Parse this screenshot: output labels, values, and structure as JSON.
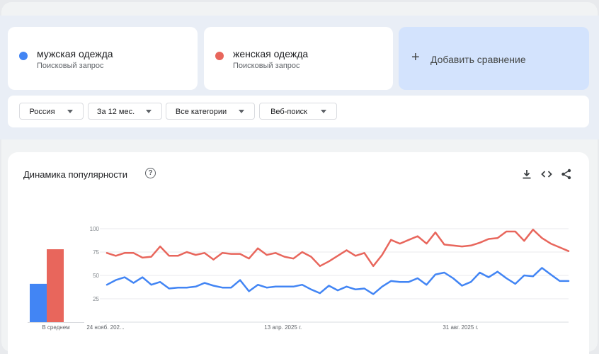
{
  "terms": [
    {
      "name": "мужская одежда",
      "sub": "Поисковый запрос",
      "color": "#4285f4"
    },
    {
      "name": "женская одежда",
      "sub": "Поисковый запрос",
      "color": "#e8665c"
    }
  ],
  "add_compare": {
    "label": "Добавить сравнение",
    "icon": "plus-icon"
  },
  "filters": [
    {
      "label": "Россия"
    },
    {
      "label": "За 12 мес."
    },
    {
      "label": "Все категории"
    },
    {
      "label": "Веб-поиск"
    }
  ],
  "panel": {
    "title": "Динамика популярности",
    "help_icon": "help-icon",
    "actions": [
      "download-icon",
      "embed-code-icon",
      "share-icon"
    ]
  },
  "chart_data": {
    "type": "line",
    "title": "",
    "ylim": [
      0,
      100
    ],
    "yticks": [
      25,
      50,
      75,
      100
    ],
    "x_labels": [
      "24 нояб. 202...",
      "13 апр. 2025 г.",
      "31 авг. 2025 г."
    ],
    "x_label_indices": [
      0,
      20,
      40
    ],
    "grid": true,
    "average": {
      "label": "В среднем",
      "values": [
        41,
        78
      ]
    },
    "series": [
      {
        "name": "мужская одежда",
        "color": "#4285f4",
        "values": [
          40,
          45,
          48,
          42,
          48,
          40,
          43,
          36,
          37,
          37,
          38,
          42,
          39,
          37,
          37,
          45,
          33,
          40,
          37,
          38,
          38,
          38,
          40,
          35,
          31,
          39,
          34,
          38,
          35,
          36,
          30,
          38,
          44,
          43,
          43,
          47,
          40,
          51,
          53,
          47,
          39,
          43,
          53,
          48,
          54,
          47,
          41,
          50,
          49,
          58,
          51,
          44,
          44
        ]
      },
      {
        "name": "женская одежда",
        "color": "#e8665c",
        "values": [
          74,
          71,
          74,
          74,
          69,
          70,
          81,
          71,
          71,
          75,
          72,
          74,
          67,
          74,
          73,
          73,
          68,
          79,
          72,
          74,
          70,
          68,
          75,
          70,
          60,
          65,
          71,
          77,
          71,
          74,
          60,
          72,
          88,
          84,
          88,
          92,
          84,
          96,
          83,
          82,
          81,
          82,
          85,
          89,
          90,
          97,
          97,
          87,
          99,
          90,
          84,
          80,
          76
        ]
      }
    ]
  }
}
